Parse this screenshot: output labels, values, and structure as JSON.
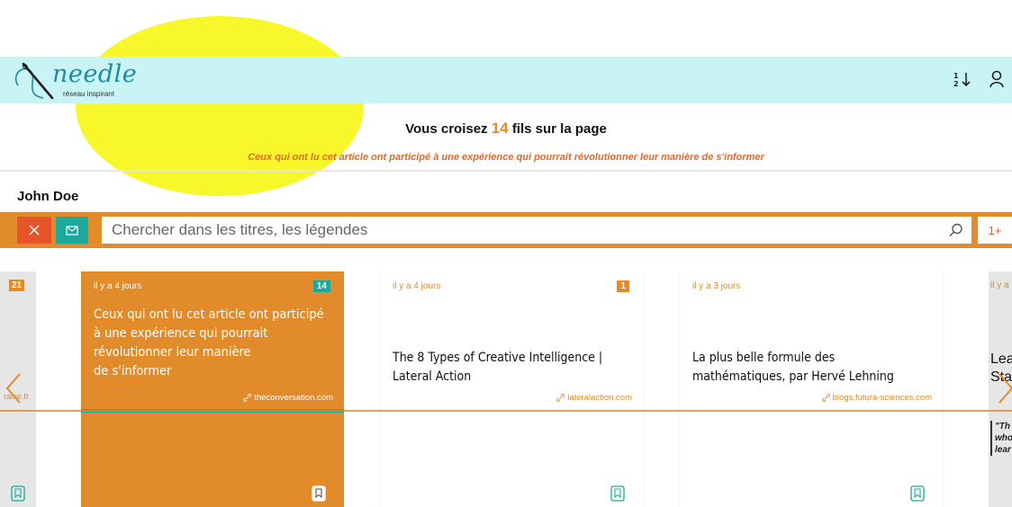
{
  "header": {
    "logo_text": "needle",
    "logo_tagline": "réseau inspirant",
    "icons": {
      "sort": "sort-numeric-icon",
      "user": "user-icon"
    }
  },
  "summary": {
    "prefix": "Vous croisez",
    "count": "14",
    "suffix": "fils sur la page",
    "subtitle": "Ceux qui ont lu cet article ont participé à une expérience qui pourrait révolutionner leur manière de s'informer"
  },
  "user": {
    "name": "John Doe"
  },
  "search": {
    "placeholder": "Chercher dans les titres, les légendes",
    "plus_label": "1+",
    "icons": {
      "close": "close-icon",
      "mail": "mail-icon",
      "search": "search-icon"
    }
  },
  "colors": {
    "accent": "#e28b2a",
    "teal": "#1aa99b",
    "red": "#e8542a",
    "header_bg": "#c9f4f6"
  },
  "carousel": {
    "left_edge": {
      "badge": "21",
      "source": "raine.fr"
    },
    "cards": [
      {
        "time": "il y a 4 jours",
        "count": "14",
        "title_lines": [
          "Ceux qui ont lu cet article ont participé",
          "à une expérience qui pourrait",
          "révolutionner leur manière",
          "de s'informer"
        ],
        "source": "theconversation.com"
      },
      {
        "time": "il y a 4 jours",
        "count": "1",
        "title_lines": [
          "The 8 Types of Creative Intelligence |",
          "Lateral Action"
        ],
        "source": "lateralaction.com"
      },
      {
        "time": "il y a 3 jours",
        "count": "",
        "title_lines": [
          "La plus belle formule des",
          "mathématiques, par Hervé Lehning"
        ],
        "source": "blogs.futura-sciences.com"
      }
    ],
    "right_edge": {
      "time": "il y a",
      "title_lines": [
        "Lea",
        "Sta"
      ],
      "quote_lines": [
        "\"Th",
        "who",
        "lear"
      ]
    }
  }
}
